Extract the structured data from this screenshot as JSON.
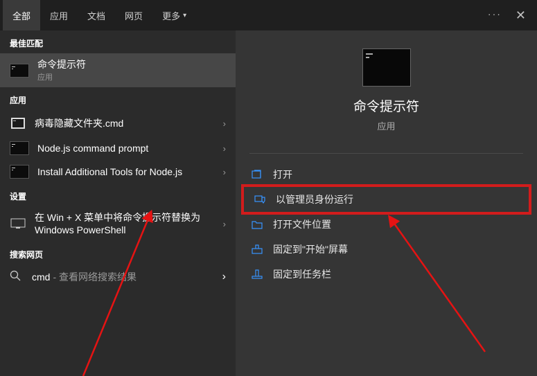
{
  "tabs": {
    "all": "全部",
    "apps": "应用",
    "docs": "文档",
    "web": "网页",
    "more": "更多"
  },
  "sections": {
    "best_match": "最佳匹配",
    "apps": "应用",
    "settings": "设置",
    "search_web": "搜索网页"
  },
  "best_match": {
    "title": "命令提示符",
    "sub": "应用"
  },
  "app_results": [
    {
      "title": "病毒隐藏文件夹.cmd"
    },
    {
      "title": "Node.js command prompt"
    },
    {
      "title": "Install Additional Tools for Node.js"
    }
  ],
  "settings_results": [
    {
      "title": "在 Win + X 菜单中将命令提示符替换为 Windows PowerShell"
    }
  ],
  "web_search": {
    "query": "cmd",
    "suffix": " - 查看网络搜索结果"
  },
  "preview": {
    "title": "命令提示符",
    "sub": "应用"
  },
  "actions": {
    "open": "打开",
    "run_admin": "以管理员身份运行",
    "open_location": "打开文件位置",
    "pin_start": "固定到\"开始\"屏幕",
    "pin_taskbar": "固定到任务栏"
  }
}
